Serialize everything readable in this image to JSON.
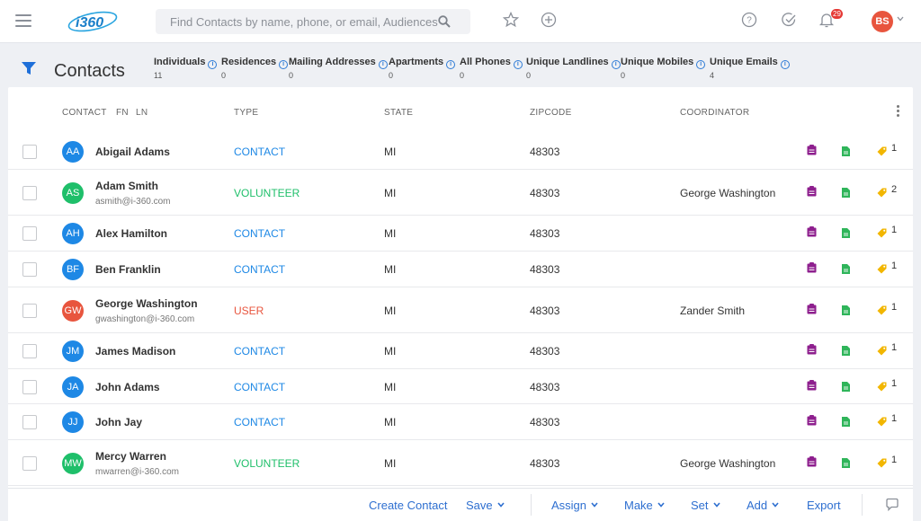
{
  "search": {
    "placeholder": "Find Contacts by name, phone, or email, Audiences"
  },
  "header": {
    "notification_count": "29",
    "user_initials": "BS",
    "user_color": "#e8553e"
  },
  "page": {
    "title": "Contacts"
  },
  "stats": [
    {
      "label": "Individuals",
      "value": "11"
    },
    {
      "label": "Residences",
      "value": "0"
    },
    {
      "label": "Mailing Addresses",
      "value": "0"
    },
    {
      "label": "Apartments",
      "value": "0"
    },
    {
      "label": "All Phones",
      "value": "0"
    },
    {
      "label": "Unique Landlines",
      "value": "0"
    },
    {
      "label": "Unique Mobiles",
      "value": "0"
    },
    {
      "label": "Unique Emails",
      "value": "4"
    }
  ],
  "table": {
    "headers": {
      "contact": "CONTACT",
      "fn": "FN",
      "ln": "LN",
      "type": "TYPE",
      "state": "STATE",
      "zipcode": "ZIPCODE",
      "coordinator": "COORDINATOR"
    },
    "rows": [
      {
        "initials": "AA",
        "avatar_color": "#1e88e5",
        "name": "Abigail Adams",
        "email": "",
        "type": "CONTACT",
        "type_color": "#1e88e5",
        "state": "MI",
        "zipcode": "48303",
        "coordinator": "",
        "tag_count": "1"
      },
      {
        "initials": "AS",
        "avatar_color": "#1fbf6a",
        "name": "Adam Smith",
        "email": "asmith@i-360.com",
        "type": "VOLUNTEER",
        "type_color": "#1fbf6a",
        "state": "MI",
        "zipcode": "48303",
        "coordinator": "George Washington",
        "tag_count": "2"
      },
      {
        "initials": "AH",
        "avatar_color": "#1e88e5",
        "name": "Alex Hamilton",
        "email": "",
        "type": "CONTACT",
        "type_color": "#1e88e5",
        "state": "MI",
        "zipcode": "48303",
        "coordinator": "",
        "tag_count": "1"
      },
      {
        "initials": "BF",
        "avatar_color": "#1e88e5",
        "name": "Ben Franklin",
        "email": "",
        "type": "CONTACT",
        "type_color": "#1e88e5",
        "state": "MI",
        "zipcode": "48303",
        "coordinator": "",
        "tag_count": "1"
      },
      {
        "initials": "GW",
        "avatar_color": "#e8553e",
        "name": "George Washington",
        "email": "gwashington@i-360.com",
        "type": "USER",
        "type_color": "#e8553e",
        "state": "MI",
        "zipcode": "48303",
        "coordinator": "Zander Smith",
        "tag_count": "1"
      },
      {
        "initials": "JM",
        "avatar_color": "#1e88e5",
        "name": "James Madison",
        "email": "",
        "type": "CONTACT",
        "type_color": "#1e88e5",
        "state": "MI",
        "zipcode": "48303",
        "coordinator": "",
        "tag_count": "1"
      },
      {
        "initials": "JA",
        "avatar_color": "#1e88e5",
        "name": "John Adams",
        "email": "",
        "type": "CONTACT",
        "type_color": "#1e88e5",
        "state": "MI",
        "zipcode": "48303",
        "coordinator": "",
        "tag_count": "1"
      },
      {
        "initials": "JJ",
        "avatar_color": "#1e88e5",
        "name": "John Jay",
        "email": "",
        "type": "CONTACT",
        "type_color": "#1e88e5",
        "state": "MI",
        "zipcode": "48303",
        "coordinator": "",
        "tag_count": "1"
      },
      {
        "initials": "MW",
        "avatar_color": "#1fbf6a",
        "name": "Mercy Warren",
        "email": "mwarren@i-360.com",
        "type": "VOLUNTEER",
        "type_color": "#1fbf6a",
        "state": "MI",
        "zipcode": "48303",
        "coordinator": "George Washington",
        "tag_count": "1"
      }
    ]
  },
  "actions": [
    {
      "label": "Create Contact",
      "dropdown": false
    },
    {
      "label": "Save",
      "dropdown": true
    },
    {
      "label": "Assign",
      "dropdown": true
    },
    {
      "label": "Make",
      "dropdown": true
    },
    {
      "label": "Set",
      "dropdown": true
    },
    {
      "label": "Add",
      "dropdown": true
    },
    {
      "label": "Export",
      "dropdown": false
    }
  ],
  "colors": {
    "accent": "#2e6fd0",
    "survey_icon": "#8e1f8e",
    "doc_icon": "#2fb55a",
    "tag_icon": "#f2b600"
  }
}
